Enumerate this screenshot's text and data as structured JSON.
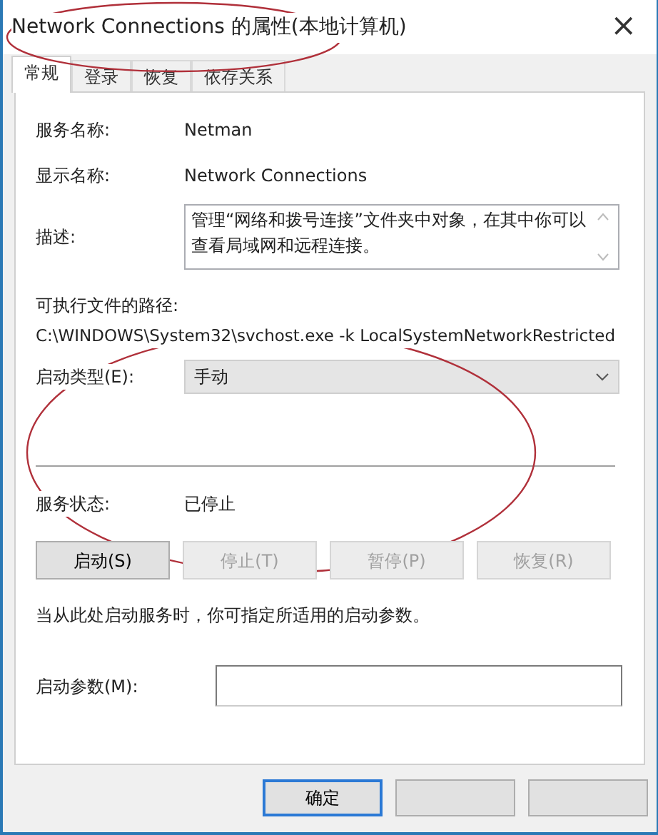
{
  "window": {
    "title": "Network Connections 的属性(本地计算机)",
    "close": "×"
  },
  "tabs": [
    {
      "label": "常规",
      "selected": true
    },
    {
      "label": "登录",
      "selected": false
    },
    {
      "label": "恢复",
      "selected": false
    },
    {
      "label": "依存关系",
      "selected": false
    }
  ],
  "service_name": {
    "label": "服务名称:",
    "value": "Netman"
  },
  "display_name": {
    "label": "显示名称:",
    "value": "Network Connections"
  },
  "description": {
    "label": "描述:",
    "value": "管理“网络和拨号连接”文件夹中对象，在其中你可以查看局域网和远程连接。"
  },
  "path": {
    "label": "可执行文件的路径:",
    "value": "C:\\WINDOWS\\System32\\svchost.exe -k LocalSystemNetworkRestricted"
  },
  "startup_type": {
    "label": "启动类型(E):",
    "value": "手动"
  },
  "service_status": {
    "label": "服务状态:",
    "value": "已停止"
  },
  "service_buttons": [
    {
      "label": "启动(S)",
      "disabled": false
    },
    {
      "label": "停止(T)",
      "disabled": true
    },
    {
      "label": "暂停(P)",
      "disabled": true
    },
    {
      "label": "恢复(R)",
      "disabled": true
    }
  ],
  "hint": "当从此处启动服务时，你可指定所适用的启动参数。",
  "start_parameters": {
    "label": "启动参数(M):"
  },
  "dialog_buttons": [
    {
      "label": "确定",
      "default": true
    },
    {
      "default": false
    },
    {
      "default": false
    }
  ],
  "annotations": [
    {
      "kind": "ellipse",
      "color": "#b0303a"
    },
    {
      "kind": "ellipse",
      "color": "#b0303a"
    }
  ]
}
